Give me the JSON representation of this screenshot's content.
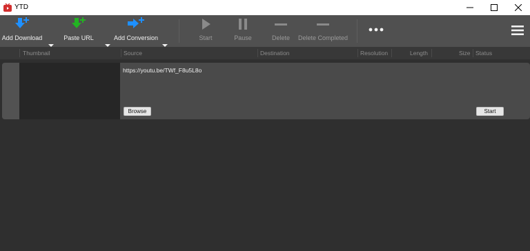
{
  "window": {
    "title": "YTD"
  },
  "toolbar": {
    "add_download": "Add Download",
    "paste_url": "Paste URL",
    "add_conversion": "Add Conversion",
    "start": "Start",
    "pause": "Pause",
    "delete": "Delete",
    "delete_completed": "Delete Completed"
  },
  "columns": {
    "thumbnail": "Thumbnail",
    "source": "Source",
    "destination": "Destination",
    "resolution": "Resolution",
    "length": "Length",
    "size": "Size",
    "status": "Status"
  },
  "item": {
    "source_url": "https://youtu.be/TWf_F8u5L8o",
    "browse_label": "Browse",
    "start_label": "Start"
  },
  "colors": {
    "add_download_icon": "#1e90ff",
    "paste_url_icon": "#22b422",
    "add_conversion_icon": "#1e90ff",
    "toolbar_bg": "#505050",
    "content_bg": "#2f2f2f",
    "app_icon": "#d32f2f"
  },
  "icons": {
    "app": "ytd-logo-icon",
    "add_download": "download-plus-icon",
    "paste_url": "paste-plus-icon",
    "add_conversion": "convert-plus-icon",
    "start": "play-icon",
    "pause": "pause-icon",
    "delete": "minus-icon",
    "delete_completed": "minus-icon",
    "more": "more-dots-icon",
    "menu": "hamburger-icon"
  }
}
